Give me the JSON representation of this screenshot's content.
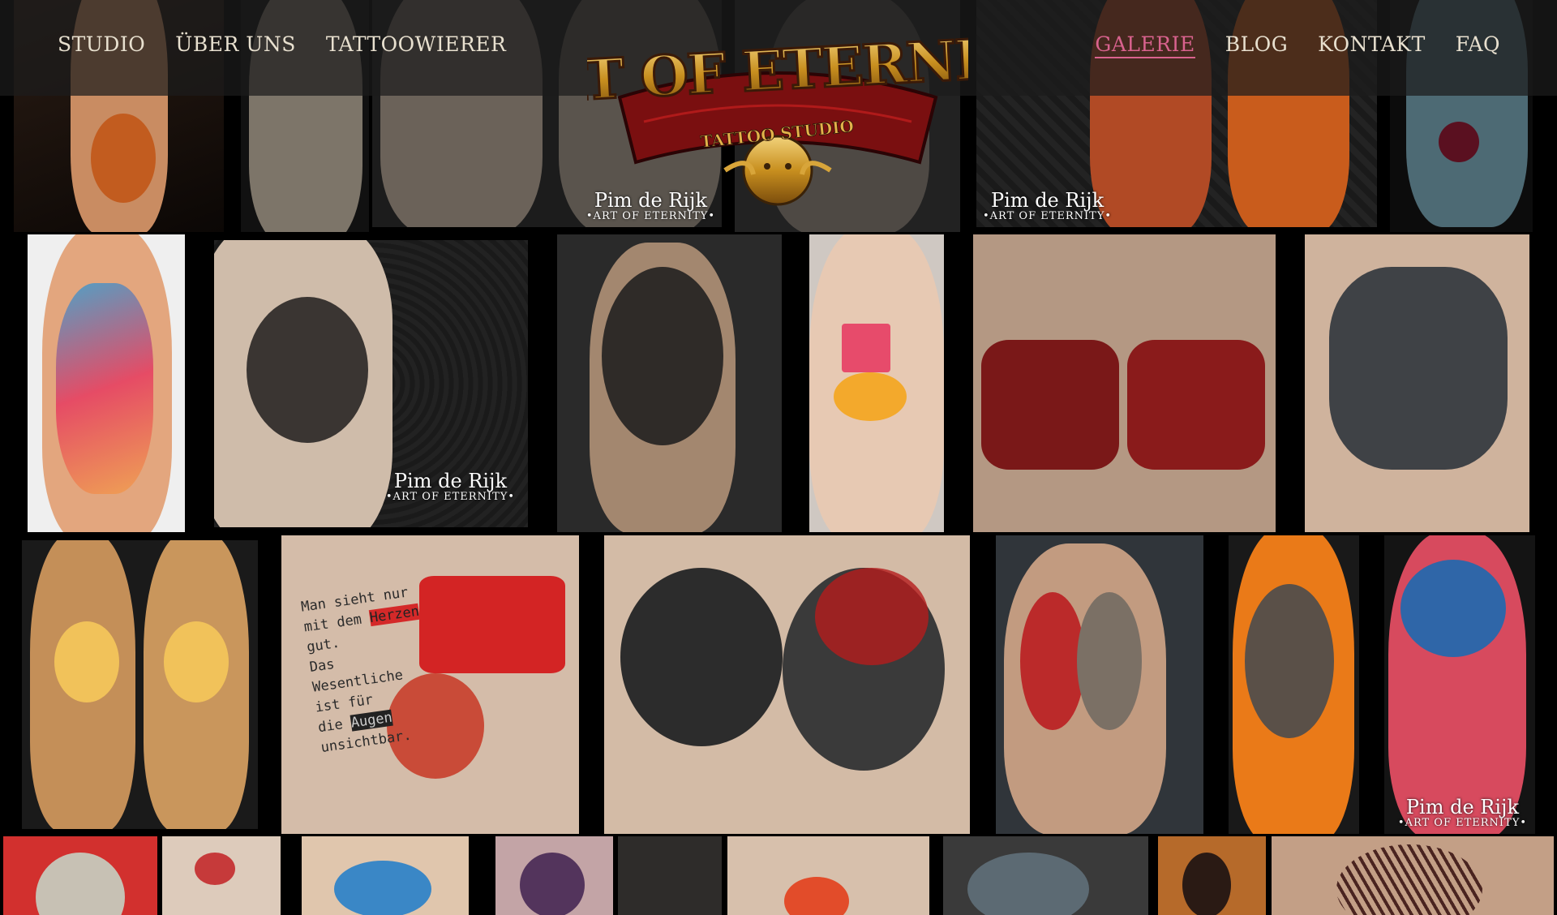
{
  "nav_left": [
    {
      "label": "STUDIO"
    },
    {
      "label": "ÜBER UNS"
    },
    {
      "label": "TATTOOWIERER"
    }
  ],
  "nav_right": [
    {
      "label": "GALERIE",
      "active": true
    },
    {
      "label": "BLOG"
    },
    {
      "label": "KONTAKT"
    },
    {
      "label": "FAQ"
    }
  ],
  "logo": {
    "title": "ART OF ETERNITY",
    "subtitle": "TATTOO STUDIO"
  },
  "credit": {
    "artist": "Pim de Rijk",
    "studio": "•ART OF ETERNITY•"
  },
  "trash_polka_text": {
    "line1": "Man sieht nur",
    "line2": "mit dem",
    "highlight1": "Herzen",
    "line3": "gut.",
    "line4": "Das",
    "line5": "Wesentliche",
    "line6": "ist für",
    "line7": "die",
    "highlight2": "Augen",
    "line8": "unsichtbar."
  },
  "colors": {
    "header_bg": "#1c1c1c",
    "nav_text": "#e8e0cf",
    "nav_active": "#d9628e",
    "logo_gold": "#d4a52c",
    "logo_red": "#8e1111"
  }
}
